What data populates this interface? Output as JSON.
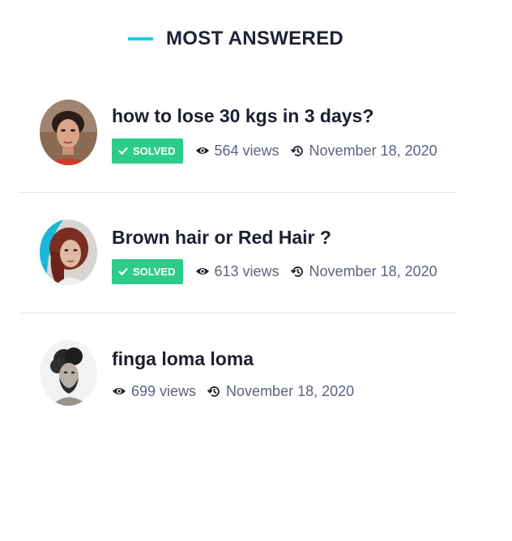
{
  "widget": {
    "title": "MOST ANSWERED",
    "accent_color": "#1ec8e8",
    "solved_color": "#2ecc8b"
  },
  "questions": [
    {
      "title": "how to lose 30 kgs in 3 days?",
      "solved": true,
      "solved_label": "SOLVED",
      "views": "564 views",
      "date": "November 18, 2020",
      "avatar": "woman-portrait"
    },
    {
      "title": "Brown hair or Red Hair ?",
      "solved": true,
      "solved_label": "SOLVED",
      "views": "613 views",
      "date": "November 18, 2020",
      "avatar": "red-hair-woman-portrait"
    },
    {
      "title": "finga loma loma",
      "solved": false,
      "views": "699 views",
      "date": "November 18, 2020",
      "avatar": "bearded-man-portrait"
    }
  ]
}
